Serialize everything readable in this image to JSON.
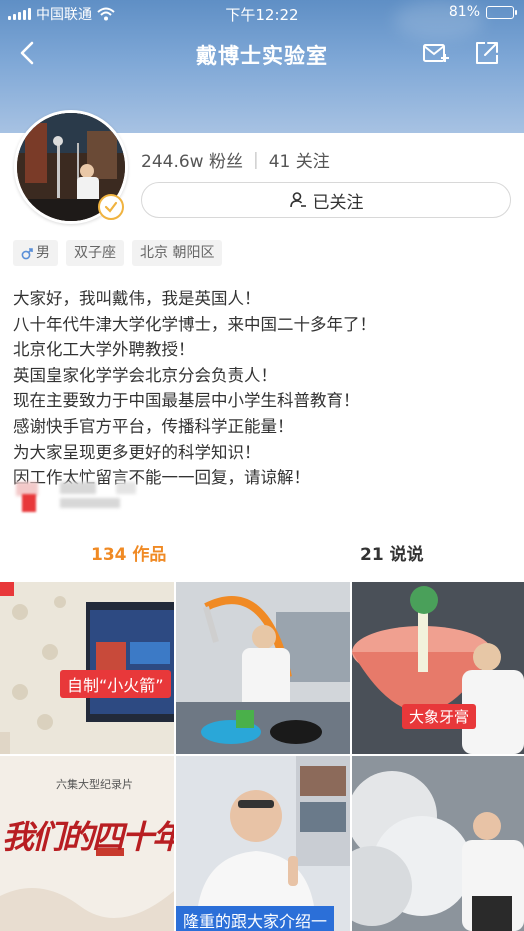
{
  "status_bar": {
    "carrier": "中国联通",
    "time": "下午12:22",
    "battery": "81%",
    "battery_level": 0.81
  },
  "nav": {
    "title": "戴博士实验室",
    "back_icon": "chevron-left-icon",
    "mail_icon": "mail-plus-icon",
    "share_icon": "share-icon"
  },
  "profile": {
    "fans": "244.6w 粉丝",
    "separator": "|",
    "following": "41 关注",
    "follow_button": "已关注",
    "tags": [
      {
        "icon": "male-icon",
        "label": "男"
      },
      {
        "label": "双子座"
      },
      {
        "label": "北京 朝阳区"
      }
    ],
    "bio": [
      "大家好，我叫戴伟，我是英国人！",
      "八十年代牛津大学化学博士，来中国二十多年了！",
      "北京化工大学外聘教授！",
      "英国皇家化学学会北京分会负责人！",
      "现在主要致力于中国最基层中小学生科普教育！",
      "感谢快手官方平台，传播科学正能量！",
      "为大家呈现更多更好的科学知识！",
      "因工作太忙留言不能一一回复，请谅解！"
    ]
  },
  "tabs": {
    "works": "134 作品",
    "talks": "21 说说"
  },
  "videos": [
    {
      "label": "自制“小火箭”"
    },
    {
      "label": ""
    },
    {
      "label": "大象牙膏"
    },
    {
      "label": "我们的四十年",
      "caption": "六集大型纪录片"
    },
    {
      "label": "隆重的跟大家介绍一"
    },
    {
      "label": ""
    }
  ],
  "colors": {
    "header": "#7ea7d6",
    "accent": "#f08a24",
    "label_red": "#e8383a"
  }
}
